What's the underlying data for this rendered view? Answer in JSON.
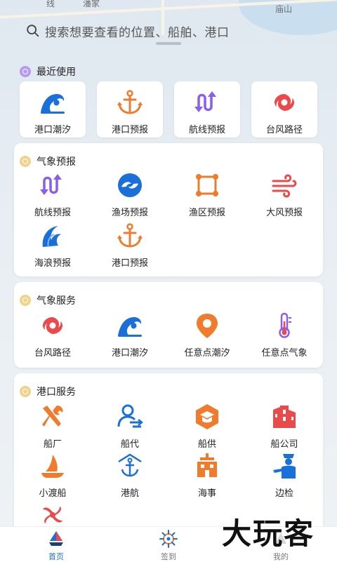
{
  "map": {
    "labels": [
      "潘家",
      "庙山",
      "线"
    ]
  },
  "search": {
    "placeholder": "搜索想要查看的位置、船舶、港口"
  },
  "recent": {
    "title": "最近使用",
    "items": [
      {
        "label": "港口潮汐",
        "icon": "wave-icon"
      },
      {
        "label": "港口预报",
        "icon": "anchor-icon"
      },
      {
        "label": "航线预报",
        "icon": "route-icon"
      },
      {
        "label": "台风路径",
        "icon": "typhoon-icon"
      }
    ]
  },
  "weather_forecast": {
    "title": "气象预报",
    "items": [
      {
        "label": "航线预报",
        "icon": "route-icon"
      },
      {
        "label": "渔场预报",
        "icon": "fish-icon"
      },
      {
        "label": "渔区预报",
        "icon": "fishing-area-icon"
      },
      {
        "label": "大风预报",
        "icon": "wind-icon"
      },
      {
        "label": "海浪预报",
        "icon": "sea-wave-icon"
      },
      {
        "label": "港口预报",
        "icon": "anchor-icon"
      }
    ]
  },
  "weather_service": {
    "title": "气象服务",
    "items": [
      {
        "label": "台风路径",
        "icon": "typhoon-icon"
      },
      {
        "label": "港口潮汐",
        "icon": "wave-icon"
      },
      {
        "label": "任意点潮汐",
        "icon": "location-pin-icon"
      },
      {
        "label": "任意点气象",
        "icon": "thermometer-icon"
      }
    ]
  },
  "port_service": {
    "title": "港口服务",
    "items": [
      {
        "label": "船厂",
        "icon": "tools-icon"
      },
      {
        "label": "船代",
        "icon": "agent-icon"
      },
      {
        "label": "船供",
        "icon": "supply-icon"
      },
      {
        "label": "船公司",
        "icon": "company-icon"
      },
      {
        "label": "小渡船",
        "icon": "sailboat-icon"
      },
      {
        "label": "港航",
        "icon": "port-anchor-icon"
      },
      {
        "label": "海事",
        "icon": "maritime-building-icon"
      },
      {
        "label": "边检",
        "icon": "officer-icon"
      },
      {
        "label": "",
        "icon": "propeller-icon"
      }
    ]
  },
  "tabbar": {
    "items": [
      {
        "label": "首页",
        "icon": "home-sail-icon",
        "active": true
      },
      {
        "label": "签到",
        "icon": "helm-icon",
        "active": false
      },
      {
        "label": "我的",
        "icon": "profile-icon",
        "active": false
      }
    ]
  },
  "watermark": "大玩客",
  "colors": {
    "blue": "#1a6fd8",
    "orange": "#f07b2c",
    "purple": "#8a5cf0",
    "red": "#ea4a4a",
    "tab_active": "#1a6fd8",
    "tab_inactive": "#999999",
    "recent_dot": "#b49af0",
    "section_dot": "#f0d38a"
  }
}
